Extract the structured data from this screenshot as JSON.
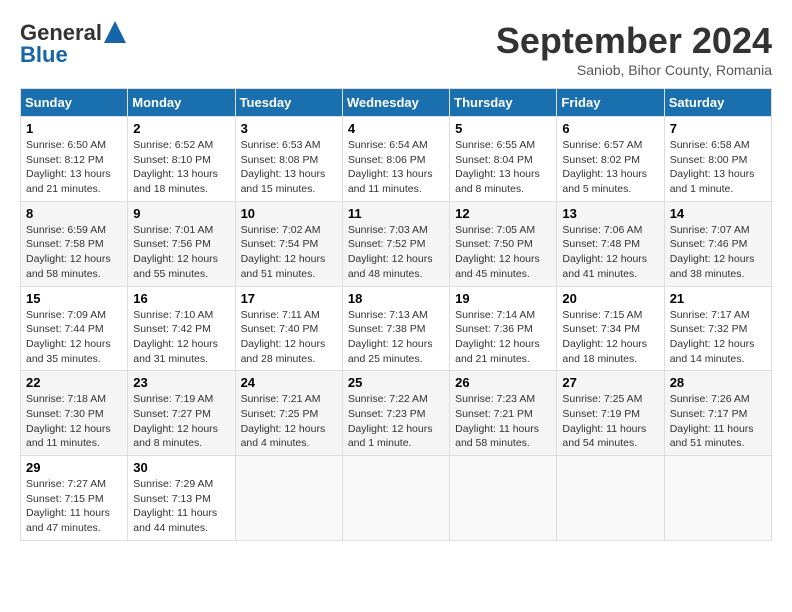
{
  "header": {
    "logo_line1": "General",
    "logo_line2": "Blue",
    "month": "September 2024",
    "location": "Saniob, Bihor County, Romania"
  },
  "weekdays": [
    "Sunday",
    "Monday",
    "Tuesday",
    "Wednesday",
    "Thursday",
    "Friday",
    "Saturday"
  ],
  "weeks": [
    [
      {
        "day": "1",
        "info": "Sunrise: 6:50 AM\nSunset: 8:12 PM\nDaylight: 13 hours\nand 21 minutes."
      },
      {
        "day": "2",
        "info": "Sunrise: 6:52 AM\nSunset: 8:10 PM\nDaylight: 13 hours\nand 18 minutes."
      },
      {
        "day": "3",
        "info": "Sunrise: 6:53 AM\nSunset: 8:08 PM\nDaylight: 13 hours\nand 15 minutes."
      },
      {
        "day": "4",
        "info": "Sunrise: 6:54 AM\nSunset: 8:06 PM\nDaylight: 13 hours\nand 11 minutes."
      },
      {
        "day": "5",
        "info": "Sunrise: 6:55 AM\nSunset: 8:04 PM\nDaylight: 13 hours\nand 8 minutes."
      },
      {
        "day": "6",
        "info": "Sunrise: 6:57 AM\nSunset: 8:02 PM\nDaylight: 13 hours\nand 5 minutes."
      },
      {
        "day": "7",
        "info": "Sunrise: 6:58 AM\nSunset: 8:00 PM\nDaylight: 13 hours\nand 1 minute."
      }
    ],
    [
      {
        "day": "8",
        "info": "Sunrise: 6:59 AM\nSunset: 7:58 PM\nDaylight: 12 hours\nand 58 minutes."
      },
      {
        "day": "9",
        "info": "Sunrise: 7:01 AM\nSunset: 7:56 PM\nDaylight: 12 hours\nand 55 minutes."
      },
      {
        "day": "10",
        "info": "Sunrise: 7:02 AM\nSunset: 7:54 PM\nDaylight: 12 hours\nand 51 minutes."
      },
      {
        "day": "11",
        "info": "Sunrise: 7:03 AM\nSunset: 7:52 PM\nDaylight: 12 hours\nand 48 minutes."
      },
      {
        "day": "12",
        "info": "Sunrise: 7:05 AM\nSunset: 7:50 PM\nDaylight: 12 hours\nand 45 minutes."
      },
      {
        "day": "13",
        "info": "Sunrise: 7:06 AM\nSunset: 7:48 PM\nDaylight: 12 hours\nand 41 minutes."
      },
      {
        "day": "14",
        "info": "Sunrise: 7:07 AM\nSunset: 7:46 PM\nDaylight: 12 hours\nand 38 minutes."
      }
    ],
    [
      {
        "day": "15",
        "info": "Sunrise: 7:09 AM\nSunset: 7:44 PM\nDaylight: 12 hours\nand 35 minutes."
      },
      {
        "day": "16",
        "info": "Sunrise: 7:10 AM\nSunset: 7:42 PM\nDaylight: 12 hours\nand 31 minutes."
      },
      {
        "day": "17",
        "info": "Sunrise: 7:11 AM\nSunset: 7:40 PM\nDaylight: 12 hours\nand 28 minutes."
      },
      {
        "day": "18",
        "info": "Sunrise: 7:13 AM\nSunset: 7:38 PM\nDaylight: 12 hours\nand 25 minutes."
      },
      {
        "day": "19",
        "info": "Sunrise: 7:14 AM\nSunset: 7:36 PM\nDaylight: 12 hours\nand 21 minutes."
      },
      {
        "day": "20",
        "info": "Sunrise: 7:15 AM\nSunset: 7:34 PM\nDaylight: 12 hours\nand 18 minutes."
      },
      {
        "day": "21",
        "info": "Sunrise: 7:17 AM\nSunset: 7:32 PM\nDaylight: 12 hours\nand 14 minutes."
      }
    ],
    [
      {
        "day": "22",
        "info": "Sunrise: 7:18 AM\nSunset: 7:30 PM\nDaylight: 12 hours\nand 11 minutes."
      },
      {
        "day": "23",
        "info": "Sunrise: 7:19 AM\nSunset: 7:27 PM\nDaylight: 12 hours\nand 8 minutes."
      },
      {
        "day": "24",
        "info": "Sunrise: 7:21 AM\nSunset: 7:25 PM\nDaylight: 12 hours\nand 4 minutes."
      },
      {
        "day": "25",
        "info": "Sunrise: 7:22 AM\nSunset: 7:23 PM\nDaylight: 12 hours\nand 1 minute."
      },
      {
        "day": "26",
        "info": "Sunrise: 7:23 AM\nSunset: 7:21 PM\nDaylight: 11 hours\nand 58 minutes."
      },
      {
        "day": "27",
        "info": "Sunrise: 7:25 AM\nSunset: 7:19 PM\nDaylight: 11 hours\nand 54 minutes."
      },
      {
        "day": "28",
        "info": "Sunrise: 7:26 AM\nSunset: 7:17 PM\nDaylight: 11 hours\nand 51 minutes."
      }
    ],
    [
      {
        "day": "29",
        "info": "Sunrise: 7:27 AM\nSunset: 7:15 PM\nDaylight: 11 hours\nand 47 minutes."
      },
      {
        "day": "30",
        "info": "Sunrise: 7:29 AM\nSunset: 7:13 PM\nDaylight: 11 hours\nand 44 minutes."
      },
      {
        "day": "",
        "info": ""
      },
      {
        "day": "",
        "info": ""
      },
      {
        "day": "",
        "info": ""
      },
      {
        "day": "",
        "info": ""
      },
      {
        "day": "",
        "info": ""
      }
    ]
  ]
}
